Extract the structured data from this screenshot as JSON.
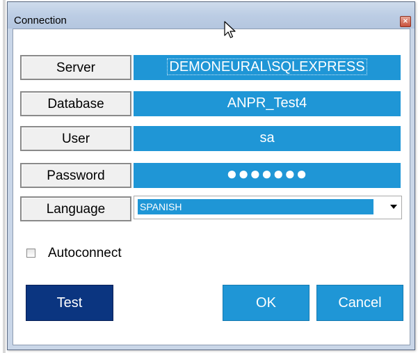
{
  "window": {
    "title": "Connection",
    "close_icon": "close-icon"
  },
  "fields": {
    "server": {
      "label": "Server",
      "value": "DEMONEURAL\\SQLEXPRESS"
    },
    "database": {
      "label": "Database",
      "value": "ANPR_Test4"
    },
    "user": {
      "label": "User",
      "value": "sa"
    },
    "password": {
      "label": "Password",
      "value": "●●●●●●●"
    },
    "language": {
      "label": "Language",
      "value": "SPANISH"
    }
  },
  "autoconnect": {
    "label": "Autoconnect",
    "checked": false
  },
  "buttons": {
    "test": "Test",
    "ok": "OK",
    "cancel": "Cancel"
  },
  "colors": {
    "accent": "#1f96d6",
    "primary_dark": "#0b3580",
    "title_bar": "#c9d6e8",
    "close_red": "#c9503c"
  }
}
